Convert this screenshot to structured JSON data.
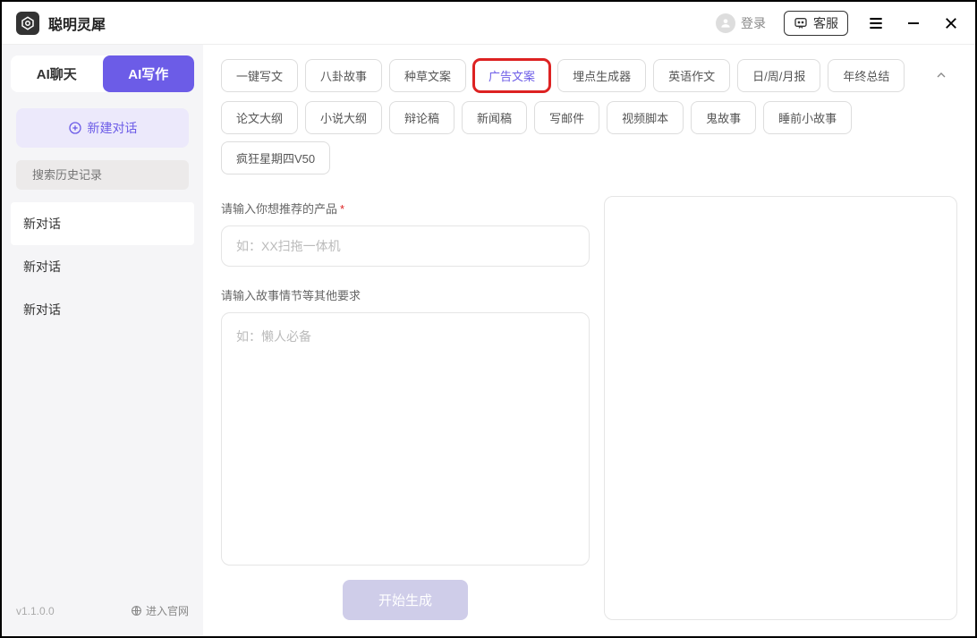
{
  "titlebar": {
    "app_name": "聪明灵犀",
    "login_label": "登录",
    "support_label": "客服"
  },
  "sidebar": {
    "mode_tabs": {
      "chat": "AI聊天",
      "write": "AI写作",
      "active": "write"
    },
    "new_chat_label": "新建对话",
    "search_placeholder": "搜索历史记录",
    "chats": [
      "新对话",
      "新对话",
      "新对话"
    ],
    "version": "v1.1.0.0",
    "official_label": "进入官网"
  },
  "categories": {
    "row1": [
      "一键写文",
      "八卦故事",
      "种草文案",
      "广告文案",
      "埋点生成器",
      "英语作文",
      "日/周/月报",
      "年终总结"
    ],
    "row2": [
      "论文大纲",
      "小说大纲",
      "辩论稿",
      "新闻稿",
      "写邮件",
      "视频脚本",
      "鬼故事",
      "睡前小故事",
      "疯狂星期四V50"
    ],
    "highlighted": "广告文案"
  },
  "form": {
    "label1": "请输入你想推荐的产品",
    "placeholder1": "如：XX扫拖一体机",
    "label2": "请输入故事情节等其他要求",
    "placeholder2": "如：懒人必备",
    "generate_label": "开始生成"
  }
}
